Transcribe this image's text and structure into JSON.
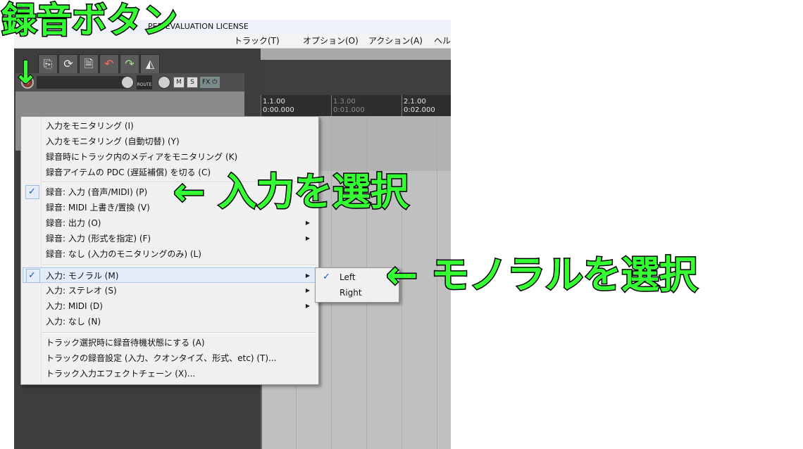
{
  "window": {
    "title": "PER  EVALUATION LICENSE",
    "menus": [
      "トラック(T)",
      "オプション(O)",
      "アクション(A)",
      "ヘル"
    ]
  },
  "ruler": {
    "labels": [
      {
        "bar": "1.1.00",
        "time": "0:00.000",
        "style": "bright"
      },
      {
        "bar": "1.3.00",
        "time": "0:01.000",
        "style": "dim"
      },
      {
        "bar": "2.1.00",
        "time": "0:02.000",
        "style": "bright"
      }
    ]
  },
  "track": {
    "route_label": "ROUTE",
    "mute_label": "M",
    "solo_label": "S",
    "fx_label": "FX"
  },
  "menu": {
    "items": [
      {
        "label": "入力をモニタリング (I)",
        "checked": false,
        "submenu": false
      },
      {
        "label": "入力をモニタリング (自動切替) (Y)",
        "checked": false,
        "submenu": false
      },
      {
        "label": "録音時にトラック内のメディアをモニタリング (K)",
        "checked": false,
        "submenu": false
      },
      {
        "label": "録音アイテムの PDC (遅延補償) を切る (C)",
        "checked": false,
        "submenu": false
      },
      {
        "label": "録音: 入力 (音声/MIDI) (P)",
        "checked": true,
        "submenu": false
      },
      {
        "label": "録音: MIDI 上書き/置換 (V)",
        "checked": false,
        "submenu": false
      },
      {
        "label": "録音: 出力 (O)",
        "checked": false,
        "submenu": true
      },
      {
        "label": "録音: 入力 (形式を指定) (F)",
        "checked": false,
        "submenu": true
      },
      {
        "label": "録音: なし (入力のモニタリングのみ) (L)",
        "checked": false,
        "submenu": false
      },
      {
        "label": "入力: モノラル (M)",
        "checked": true,
        "submenu": true,
        "highlighted": true
      },
      {
        "label": "入力: ステレオ (S)",
        "checked": false,
        "submenu": true
      },
      {
        "label": "入力: MIDI (D)",
        "checked": false,
        "submenu": true
      },
      {
        "label": "入力: なし (N)",
        "checked": false,
        "submenu": false
      },
      {
        "label": "トラック選択時に録音待機状態にする (A)",
        "checked": false,
        "submenu": false
      },
      {
        "label": "トラックの録音設定 (入力、クオンタイズ、形式、etc) (T)...",
        "checked": false,
        "submenu": false
      },
      {
        "label": "トラック入力エフェクトチェーン (X)...",
        "checked": false,
        "submenu": false
      }
    ],
    "check_glyph": "✓",
    "submenu_glyph": "▶"
  },
  "submenu": {
    "items": [
      {
        "label": "Left",
        "checked": true
      },
      {
        "label": "Right",
        "checked": false
      }
    ]
  },
  "annotations": {
    "title": "録音ボタン",
    "down_arrow": "↓",
    "input_select": "← 入力を選択",
    "mono_select": "← モノラルを選択",
    "color": "#33ff33"
  },
  "icons": [
    "record-button-icon",
    "route-icon",
    "volume-knob-icon",
    "pan-knob-icon",
    "fx-icon",
    "toolbar-icons"
  ]
}
